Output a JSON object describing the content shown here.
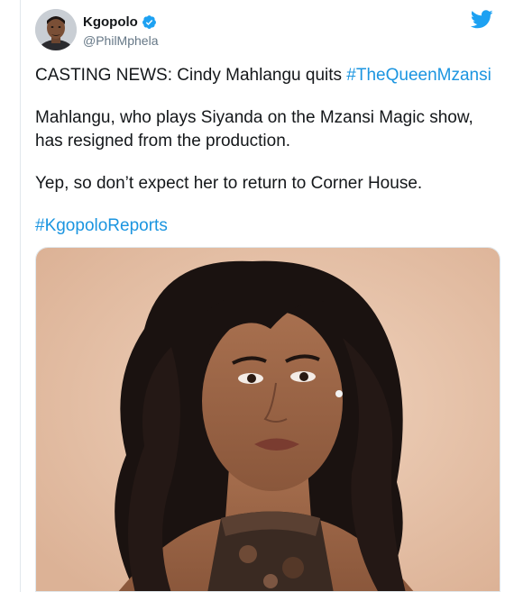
{
  "user": {
    "display_name": "Kgopolo",
    "handle": "@PhilMphela",
    "avatar_icon": "profile-photo",
    "verified_icon": "verified-badge-icon"
  },
  "brand": {
    "icon": "twitter-bird-icon",
    "accent_color": "#1da1f2"
  },
  "tweet": {
    "line1_text": "CASTING NEWS: Cindy Mahlangu quits ",
    "line1_hashtag": "#TheQueenMzansi",
    "paragraph2_line1": "Mahlangu, who plays Siyanda on the Mzansi Magic show,",
    "paragraph2_line2": "has resigned from the production.",
    "paragraph3": "Yep, so don’t expect her to return to Corner House.",
    "hashtag2": "#KgopoloReports"
  },
  "media": {
    "type": "photo",
    "subject_icon": "portrait-photo"
  },
  "colors": {
    "text": "#14171a",
    "secondary": "#657786",
    "link": "#1b95e0",
    "photo_background": "#e7c6ae"
  }
}
